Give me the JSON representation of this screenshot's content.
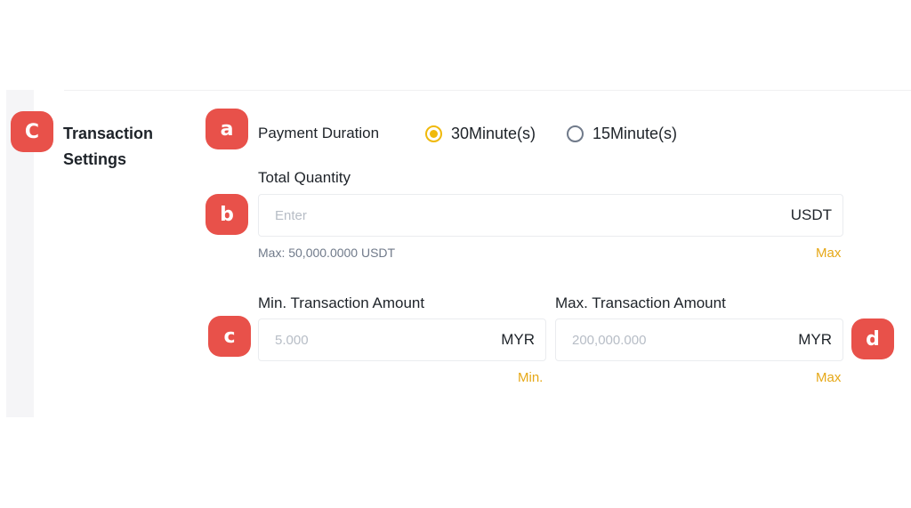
{
  "markers": {
    "section": "C",
    "a": "a",
    "b": "b",
    "c": "c",
    "d": "d"
  },
  "section": {
    "title_line1": "Transaction",
    "title_line2": "Settings"
  },
  "payment_duration": {
    "label": "Payment Duration",
    "options": [
      {
        "label": "30Minute(s)",
        "selected": true
      },
      {
        "label": "15Minute(s)",
        "selected": false
      }
    ]
  },
  "total_quantity": {
    "label": "Total Quantity",
    "placeholder": "Enter",
    "unit": "USDT",
    "hint": "Max: 50,000.0000 USDT",
    "max_link": "Max"
  },
  "min_amount": {
    "label": "Min. Transaction Amount",
    "placeholder": "5.000",
    "unit": "MYR",
    "link": "Min."
  },
  "max_amount": {
    "label": "Max. Transaction Amount",
    "placeholder": "200,000.000",
    "unit": "MYR",
    "link": "Max"
  },
  "colors": {
    "accent": "#f0b90b",
    "marker": "#e8514a",
    "link": "#e6a817"
  }
}
